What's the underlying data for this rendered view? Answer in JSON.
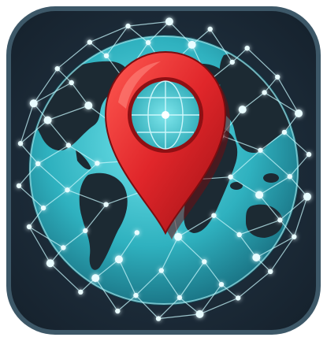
{
  "icon": {
    "subject": "location-pin-over-network-globe-icon",
    "colors": {
      "tile_dark": "#1c2a35",
      "tile_rim": "#3a5566",
      "ocean": "#2fb8c4",
      "land": "#1e2b33",
      "network": "#bff4fa",
      "pin": "#e0262a",
      "pin_shadow": "#8e1014",
      "pin_window": "#45c7cf"
    }
  }
}
